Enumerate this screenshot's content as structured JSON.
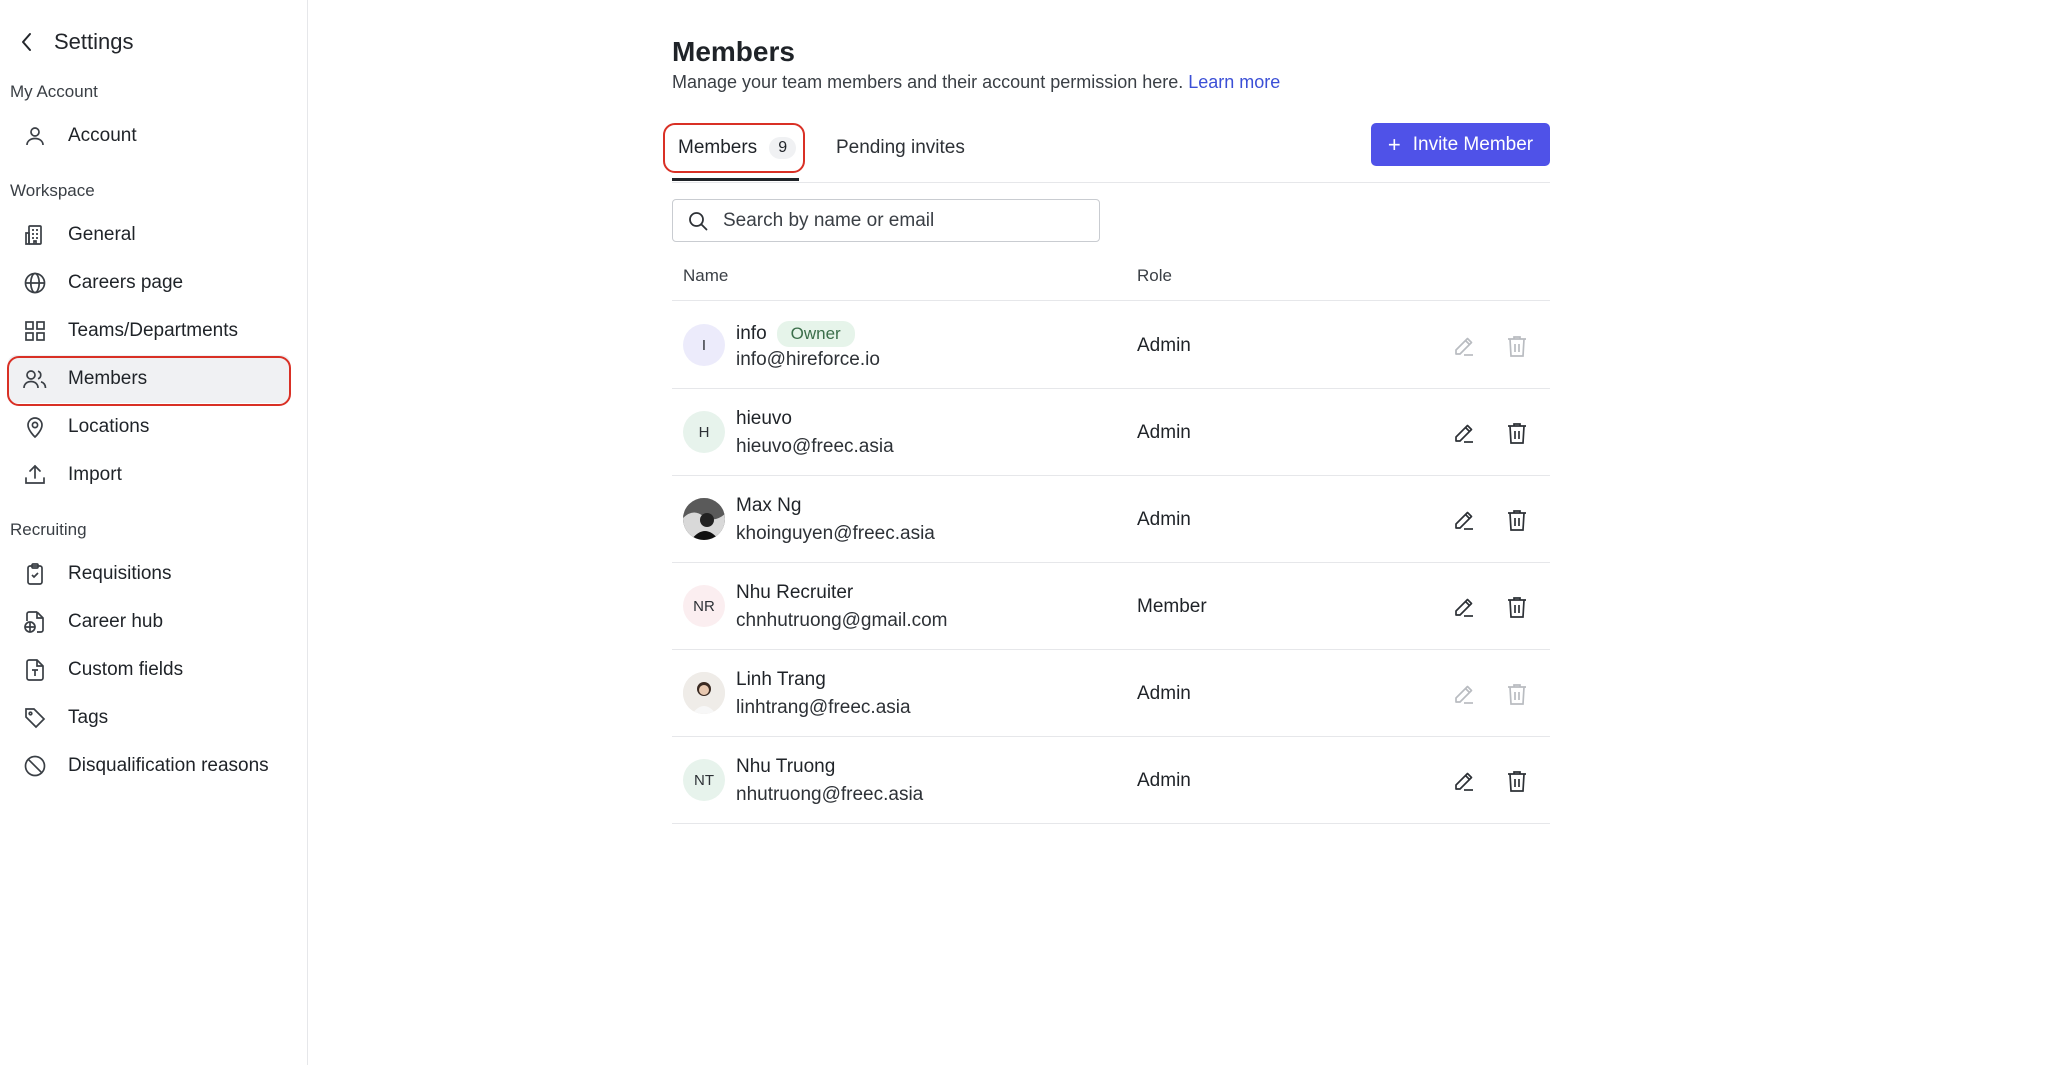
{
  "sidebar": {
    "back_label": "Settings",
    "sections": {
      "my_account": "My Account",
      "workspace": "Workspace",
      "recruiting": "Recruiting"
    },
    "items": {
      "account": "Account",
      "general": "General",
      "careers_page": "Careers page",
      "teams": "Teams/Departments",
      "members": "Members",
      "locations": "Locations",
      "import": "Import",
      "requisitions": "Requisitions",
      "career_hub": "Career hub",
      "custom_fields": "Custom fields",
      "tags": "Tags",
      "disqualification": "Disqualification reasons"
    },
    "active_item": "members"
  },
  "main": {
    "title": "Members",
    "subtitle": "Manage your team members and their account permission here.",
    "learn_more": "Learn more",
    "tabs": [
      {
        "label": "Members",
        "count": "9",
        "active": true
      },
      {
        "label": "Pending invites",
        "active": false
      }
    ],
    "invite_button": "Invite Member",
    "search_placeholder": "Search by name or email",
    "columns": {
      "name": "Name",
      "role": "Role"
    },
    "members": [
      {
        "initials": "I",
        "name": "info",
        "badge": "Owner",
        "email": "info@hireforce.io",
        "role": "Admin",
        "avatar_color": "#ecebfb",
        "actions_enabled": false
      },
      {
        "initials": "H",
        "name": "hieuvo",
        "email": "hieuvo@freec.asia",
        "role": "Admin",
        "avatar_color": "#e7f3ec",
        "actions_enabled": true
      },
      {
        "initials": "",
        "name": "Max Ng",
        "email": "khoinguyen@freec.asia",
        "role": "Admin",
        "avatar_color": "#2b2b2b",
        "actions_enabled": true
      },
      {
        "initials": "NR",
        "name": "Nhu Recruiter",
        "email": "chnhutruong@gmail.com",
        "role": "Member",
        "avatar_color": "#fbeef0",
        "actions_enabled": true
      },
      {
        "initials": "",
        "name": "Linh Trang",
        "email": "linhtrang@freec.asia",
        "role": "Admin",
        "avatar_color": "#e9e4df",
        "actions_enabled": false
      },
      {
        "initials": "NT",
        "name": "Nhu Truong",
        "email": "nhutruong@freec.asia",
        "role": "Admin",
        "avatar_color": "#e7f3ec",
        "actions_enabled": true
      }
    ]
  },
  "colors": {
    "accent": "#4f52e8",
    "link": "#3b4fd6",
    "highlight": "#d93025",
    "owner_badge_bg": "#e6f4ea"
  }
}
